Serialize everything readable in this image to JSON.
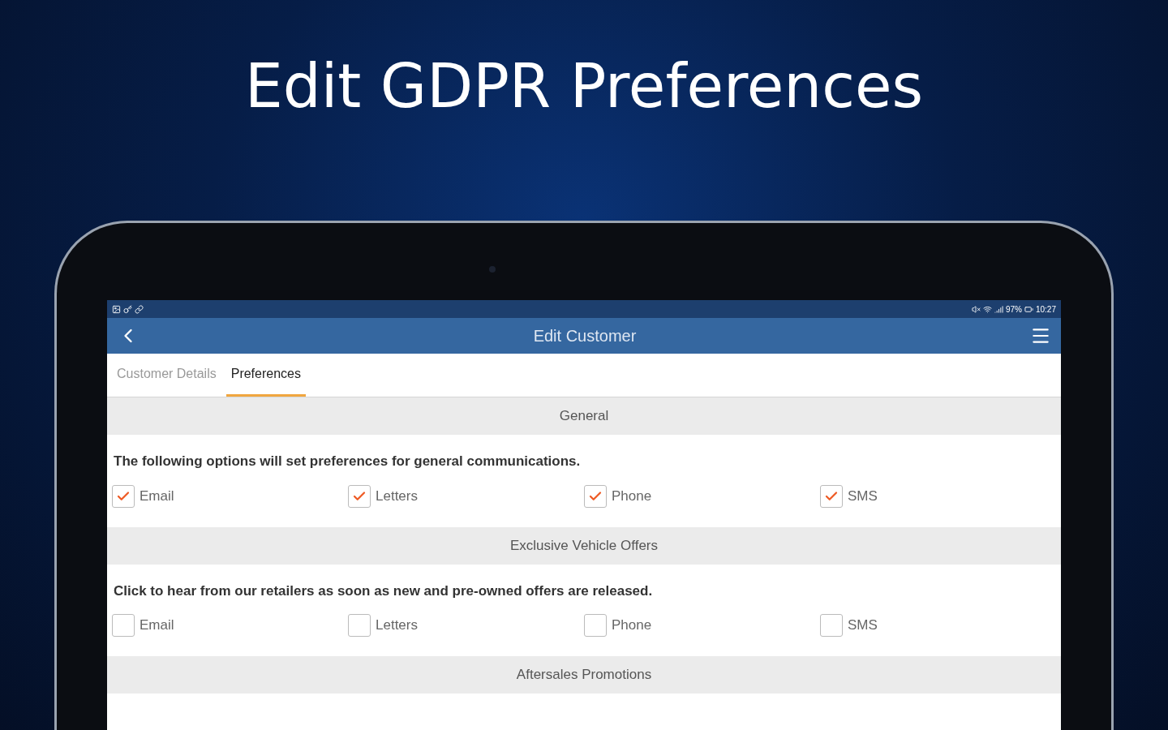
{
  "headline": "Edit GDPR Preferences",
  "status_bar": {
    "battery": "97%",
    "time": "10:27"
  },
  "app_bar": {
    "title": "Edit Customer"
  },
  "tabs": [
    {
      "label": "Customer Details",
      "selected": false
    },
    {
      "label": "Preferences",
      "selected": true
    }
  ],
  "sections": [
    {
      "title": "General",
      "description": "The following options will set preferences for general communications.",
      "options": [
        {
          "label": "Email",
          "checked": true
        },
        {
          "label": "Letters",
          "checked": true
        },
        {
          "label": "Phone",
          "checked": true
        },
        {
          "label": "SMS",
          "checked": true
        }
      ]
    },
    {
      "title": "Exclusive Vehicle Offers",
      "description": "Click to hear from our retailers as soon as new and pre-owned offers are released.",
      "options": [
        {
          "label": "Email",
          "checked": false
        },
        {
          "label": "Letters",
          "checked": false
        },
        {
          "label": "Phone",
          "checked": false
        },
        {
          "label": "SMS",
          "checked": false
        }
      ]
    },
    {
      "title": "Aftersales Promotions"
    }
  ]
}
